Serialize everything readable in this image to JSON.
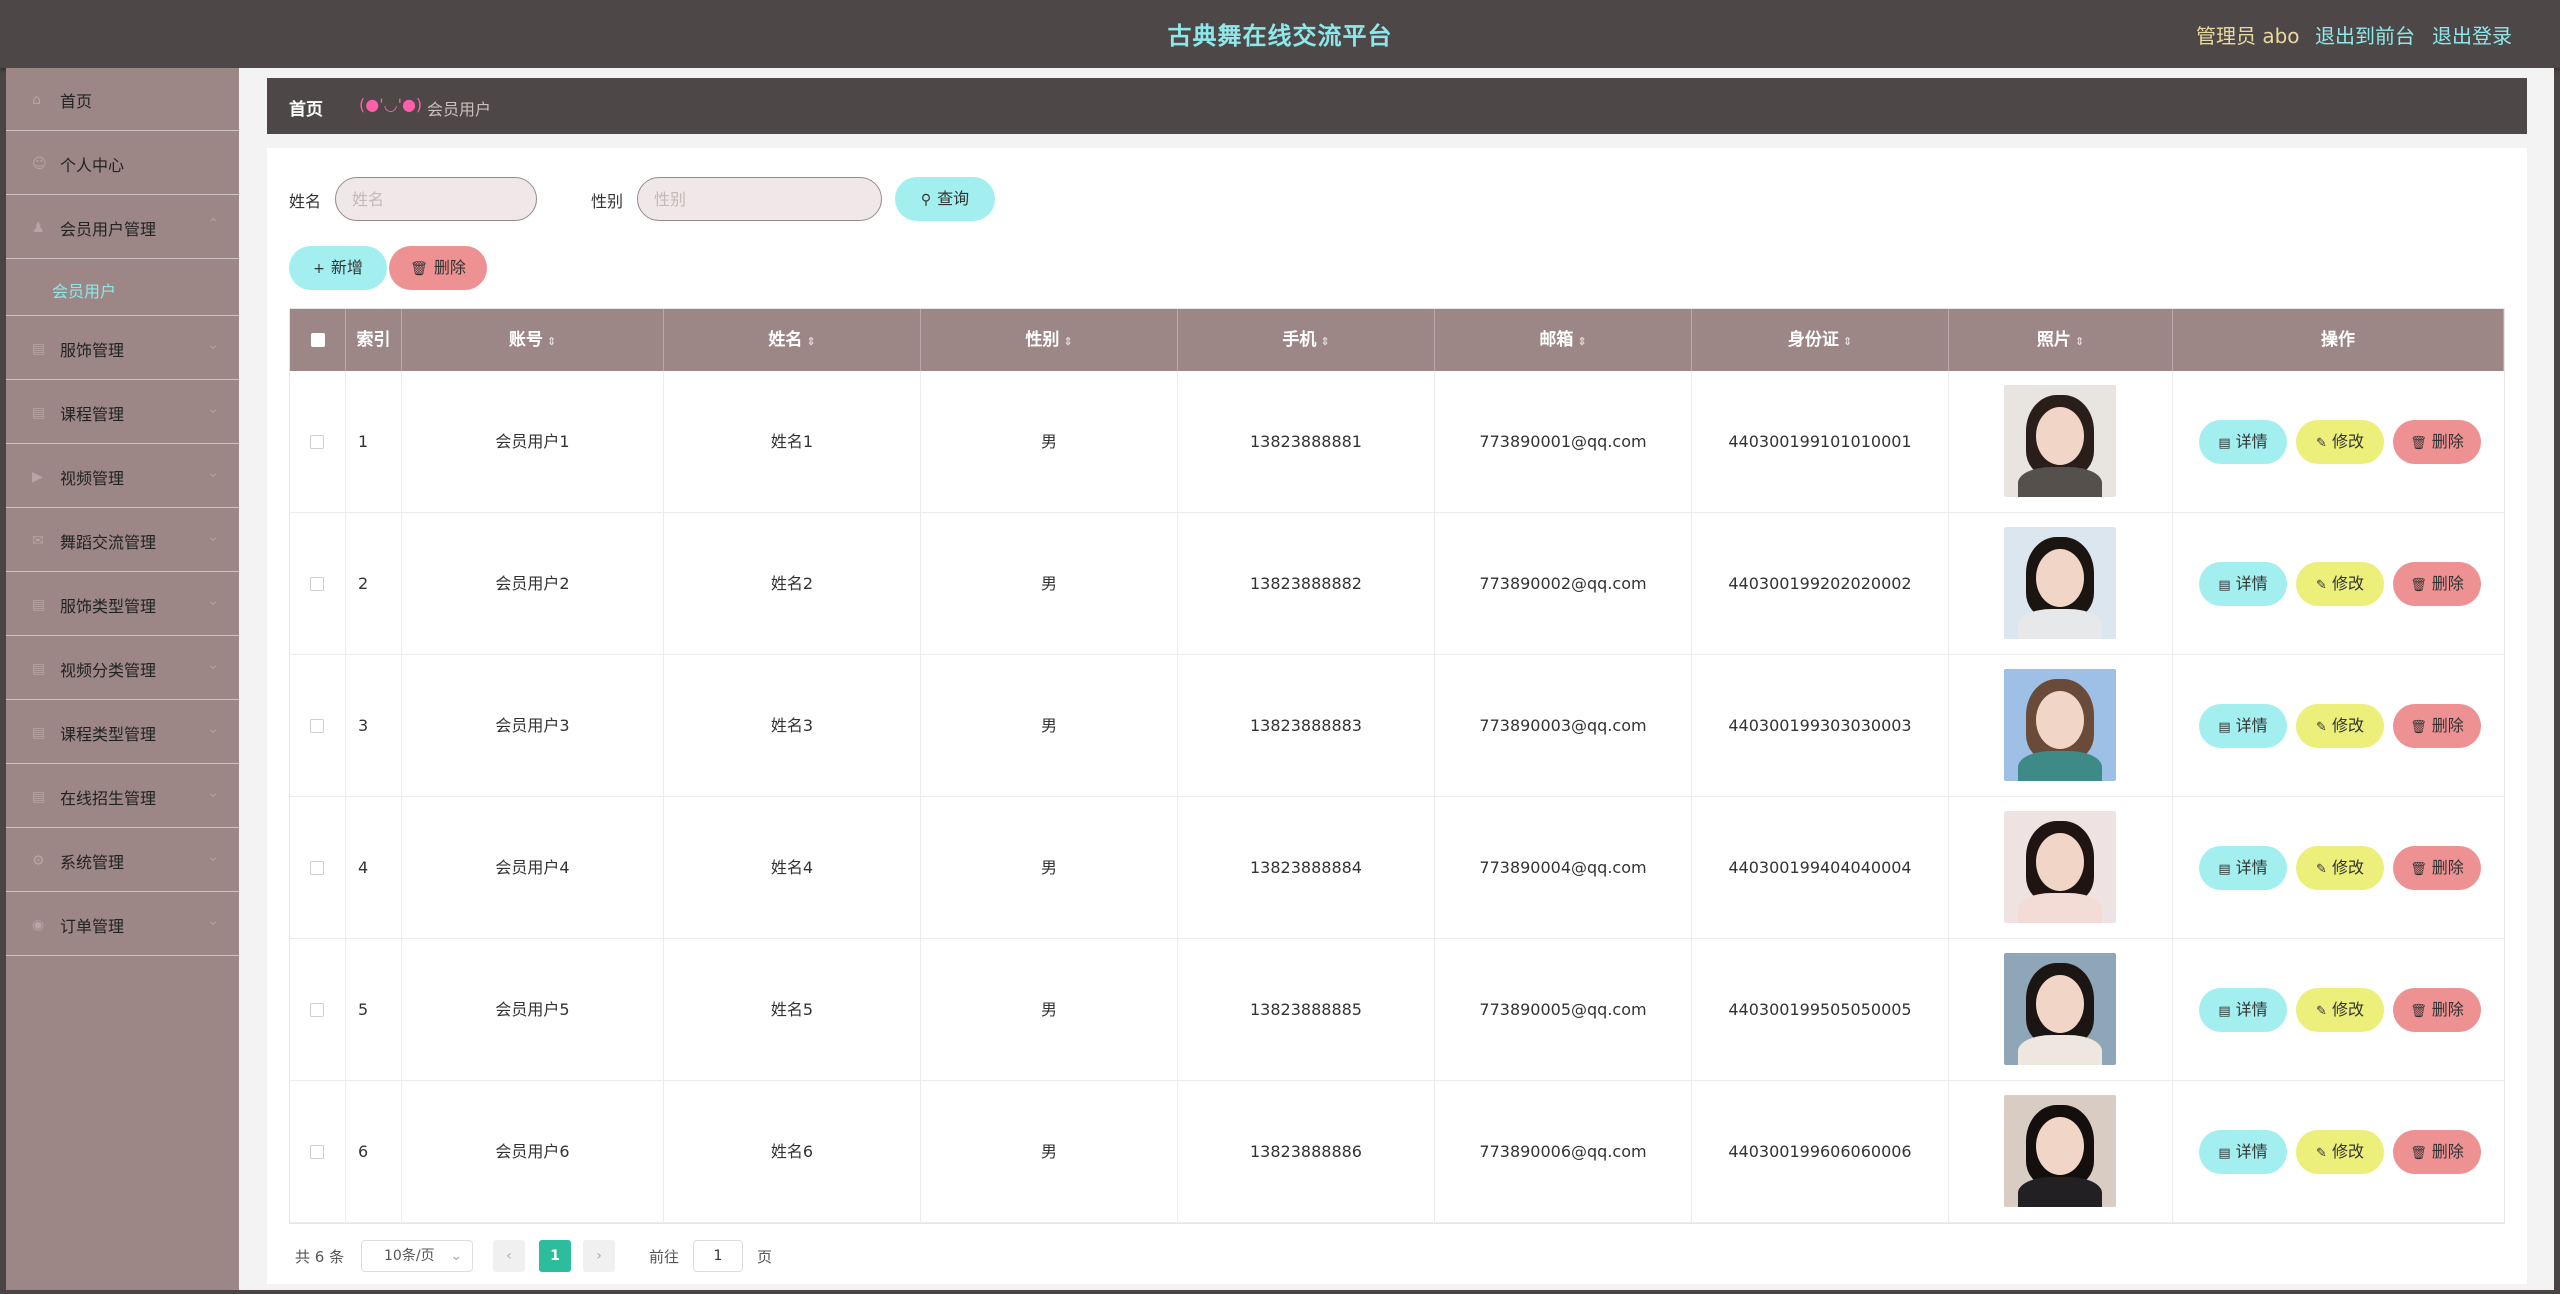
{
  "header": {
    "title": "古典舞在线交流平台",
    "admin": "管理员 abo",
    "exit_front": "退出到前台",
    "logout": "退出登录"
  },
  "sidebar": {
    "items": [
      {
        "label": "首页",
        "icon": "home-icon"
      },
      {
        "label": "个人中心",
        "icon": "user-icon"
      },
      {
        "label": "会员用户管理",
        "icon": "users-icon"
      },
      {
        "label": "服饰管理",
        "icon": "list-icon"
      },
      {
        "label": "课程管理",
        "icon": "list-icon"
      },
      {
        "label": "视频管理",
        "icon": "video-icon"
      },
      {
        "label": "舞蹈交流管理",
        "icon": "chat-icon"
      },
      {
        "label": "服饰类型管理",
        "icon": "list-icon"
      },
      {
        "label": "视频分类管理",
        "icon": "list-icon"
      },
      {
        "label": "课程类型管理",
        "icon": "list-icon"
      },
      {
        "label": "在线招生管理",
        "icon": "list-icon"
      },
      {
        "label": "系统管理",
        "icon": "gear-icon"
      },
      {
        "label": "订单管理",
        "icon": "order-icon"
      }
    ],
    "sub_item": "会员用户"
  },
  "breadcrumb": {
    "home": "首页",
    "face": "(●'◡'●)",
    "current": "会员用户"
  },
  "search": {
    "name_label": "姓名",
    "name_placeholder": "姓名",
    "gender_label": "性别",
    "gender_placeholder": "性别",
    "query_label": "查询"
  },
  "actions": {
    "add_label": "新增",
    "delete_label": "删除"
  },
  "table": {
    "headers": [
      "索引",
      "账号",
      "姓名",
      "性别",
      "手机",
      "邮箱",
      "身份证",
      "照片",
      "操作"
    ],
    "rows": [
      {
        "index": "1",
        "account": "会员用户1",
        "name": "姓名1",
        "gender": "男",
        "phone": "13823888881",
        "email": "773890001@qq.com",
        "id_card": "440300199101010001"
      },
      {
        "index": "2",
        "account": "会员用户2",
        "name": "姓名2",
        "gender": "男",
        "phone": "13823888882",
        "email": "773890002@qq.com",
        "id_card": "440300199202020002"
      },
      {
        "index": "3",
        "account": "会员用户3",
        "name": "姓名3",
        "gender": "男",
        "phone": "13823888883",
        "email": "773890003@qq.com",
        "id_card": "440300199303030003"
      },
      {
        "index": "4",
        "account": "会员用户4",
        "name": "姓名4",
        "gender": "男",
        "phone": "13823888884",
        "email": "773890004@qq.com",
        "id_card": "440300199404040004"
      },
      {
        "index": "5",
        "account": "会员用户5",
        "name": "姓名5",
        "gender": "男",
        "phone": "13823888885",
        "email": "773890005@qq.com",
        "id_card": "440300199505050005"
      },
      {
        "index": "6",
        "account": "会员用户6",
        "name": "姓名6",
        "gender": "男",
        "phone": "13823888886",
        "email": "773890006@qq.com",
        "id_card": "440300199606060006"
      }
    ],
    "row_actions": {
      "detail": "详情",
      "edit": "修改",
      "delete": "删除"
    }
  },
  "pagination": {
    "total": "共 6 条",
    "page_size": "10条/页",
    "current_page": "1",
    "goto_label": "前往",
    "goto_value": "1",
    "page_suffix": "页"
  },
  "colors": {
    "accent_cyan": "#a3eff0",
    "accent_yellow": "#ecef7a",
    "accent_red": "#ed9192",
    "header_bg": "#4d4747",
    "sidebar_bg": "#9c8786",
    "page_active": "#2cbd9c"
  }
}
